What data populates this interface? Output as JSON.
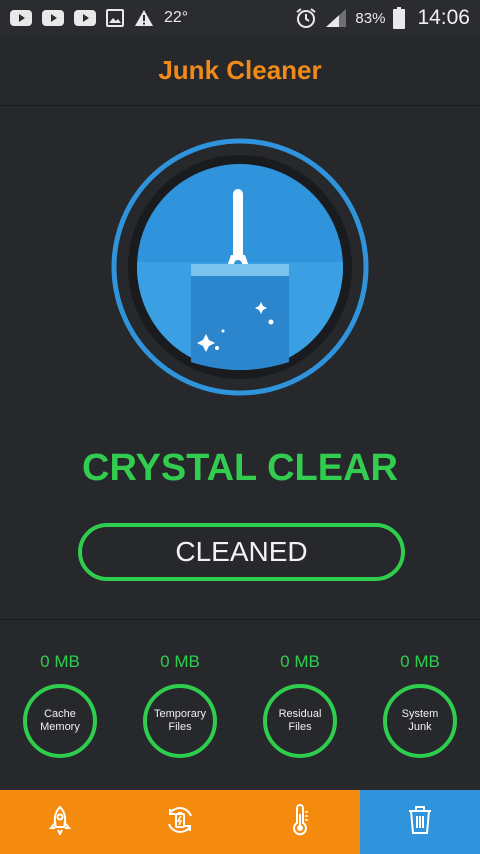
{
  "status_bar": {
    "temperature": "22°",
    "battery_percent": "83%",
    "time": "14:06",
    "icons": [
      "youtube-icon",
      "youtube-icon",
      "youtube-icon",
      "image-icon",
      "warning-icon",
      "alarm-icon",
      "signal-icon",
      "battery-icon"
    ]
  },
  "header": {
    "title": "Junk Cleaner"
  },
  "main": {
    "status_text": "CRYSTAL CLEAR",
    "button_label": "CLEANED",
    "hero_icon": "broom-icon"
  },
  "stats": [
    {
      "value": "0 MB",
      "label": "Cache\nMemory"
    },
    {
      "value": "0 MB",
      "label": "Temporary\nFiles"
    },
    {
      "value": "0 MB",
      "label": "Residual\nFiles"
    },
    {
      "value": "0 MB",
      "label": "System\nJunk"
    }
  ],
  "bottom_nav": [
    {
      "icon": "rocket-icon",
      "active": false
    },
    {
      "icon": "battery-saver-icon",
      "active": false
    },
    {
      "icon": "thermometer-icon",
      "active": false
    },
    {
      "icon": "trash-icon",
      "active": true
    }
  ],
  "colors": {
    "accent_orange": "#f48a0e",
    "title_orange": "#f08a19",
    "accent_green": "#2fcd4d",
    "accent_blue": "#2f94dc",
    "background": "#26282c"
  }
}
